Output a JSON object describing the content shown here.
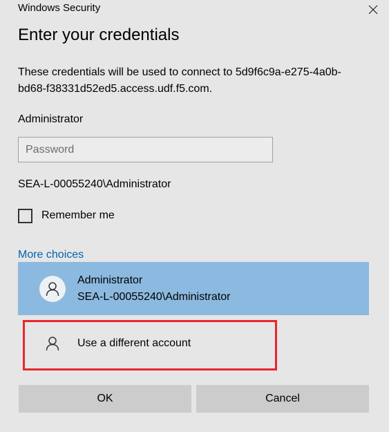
{
  "window": {
    "title": "Windows Security",
    "close_icon": "close-icon"
  },
  "dialog": {
    "heading": "Enter your credentials",
    "description": "These credentials will be used to connect to 5d9f6c9a-e275-4a0b-bd68-f38331d52ed5.access.udf.f5.com.",
    "username": "Administrator",
    "password_placeholder": "Password",
    "password_value": "",
    "domain_user": "SEA-L-00055240\\Administrator",
    "remember_label": "Remember me",
    "remember_checked": false,
    "more_choices_label": "More choices"
  },
  "accounts": [
    {
      "name": "Administrator",
      "detail": "SEA-L-00055240\\Administrator",
      "selected": true,
      "icon": "user-icon"
    },
    {
      "name": "Use a different account",
      "selected": false,
      "icon": "user-icon"
    }
  ],
  "buttons": {
    "ok_label": "OK",
    "cancel_label": "Cancel"
  },
  "colors": {
    "background": "#e6e6e6",
    "selected_account": "#8cb9df",
    "link": "#0063b1",
    "highlight_border": "#e8262b",
    "button": "#cccccc"
  }
}
